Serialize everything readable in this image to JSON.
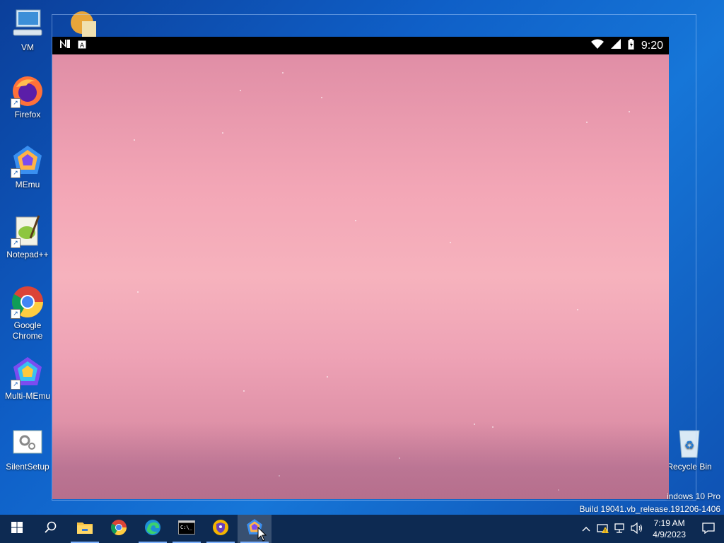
{
  "desktop": {
    "icons": [
      {
        "label": "VM"
      },
      {
        "label": "Firefox"
      },
      {
        "label": "MEmu"
      },
      {
        "label": "Notepad++"
      },
      {
        "label": "Google Chrome"
      },
      {
        "label": "Multi-MEmu"
      },
      {
        "label": "SilentSetup"
      },
      {
        "label": "Recycle Bin"
      }
    ],
    "watermark": {
      "edition": "indows 10 Pro",
      "build": "Build 19041.vb_release.191206-1406"
    }
  },
  "android": {
    "status_bar": {
      "time": "9:20",
      "left_icons": [
        "n-notification-icon",
        "a-notification-icon"
      ],
      "right_icons": [
        "wifi-icon",
        "signal-icon",
        "battery-icon"
      ]
    }
  },
  "taskbar": {
    "buttons": [
      "start-icon",
      "search-icon",
      "file-explorer-icon",
      "chrome-icon",
      "edge-icon",
      "terminal-icon",
      "shield-app-icon",
      "memu-icon"
    ],
    "active": "memu-icon",
    "tray": {
      "icons": [
        "chevron-up-icon",
        "network-warning-icon",
        "network-icon",
        "volume-icon"
      ],
      "time": "7:19 AM",
      "date": "4/9/2023"
    }
  },
  "colors": {
    "desktop_blue": "#1676d8",
    "taskbar": "#0d2a52",
    "wallpaper_pink": "#f3a6b6"
  }
}
